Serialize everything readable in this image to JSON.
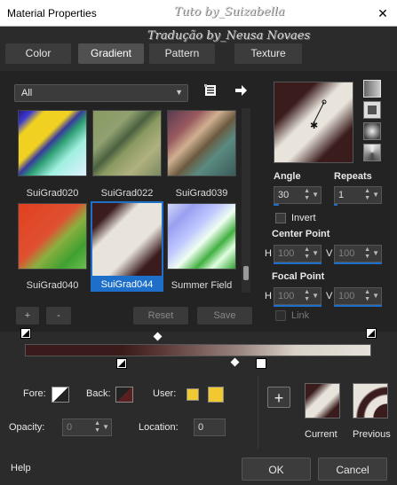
{
  "window": {
    "title": "Material Properties",
    "close_glyph": "✕"
  },
  "watermark": {
    "line1": "Tuto by_Suizabella",
    "line2": "Tradução by_Neusa Novaes"
  },
  "tabs": [
    {
      "label": "Color",
      "active": false
    },
    {
      "label": "Gradient",
      "active": true
    },
    {
      "label": "Pattern",
      "active": false
    },
    {
      "label": "Texture",
      "active": false
    }
  ],
  "library": {
    "category": "All",
    "gradients": [
      {
        "name": "SuiGrad020",
        "selected": false
      },
      {
        "name": "SuiGrad022",
        "selected": false
      },
      {
        "name": "SuiGrad039",
        "selected": false
      },
      {
        "name": "SuiGrad040",
        "selected": false
      },
      {
        "name": "SuiGrad044",
        "selected": true
      },
      {
        "name": "Summer Field",
        "selected": false
      }
    ],
    "add_label": "+",
    "remove_label": "-",
    "reset_label": "Reset",
    "save_label": "Save"
  },
  "settings": {
    "angle_label": "Angle",
    "angle_value": "30",
    "repeats_label": "Repeats",
    "repeats_value": "1",
    "invert_label": "Invert",
    "invert_checked": false,
    "center_point_label": "Center Point",
    "center_h_label": "H",
    "center_h": "100",
    "center_v_label": "V",
    "center_v": "100",
    "focal_point_label": "Focal Point",
    "focal_h_label": "H",
    "focal_h": "100",
    "focal_v_label": "V",
    "focal_v": "100",
    "link_label": "Link",
    "link_checked": false
  },
  "editor": {
    "fore_label": "Fore:",
    "back_label": "Back:",
    "user_label": "User:",
    "user_color": "#f0c830",
    "opacity_label": "Opacity:",
    "opacity_value": "0",
    "location_label": "Location:",
    "location_value": "0",
    "plus_glyph": "+"
  },
  "compare": {
    "current_label": "Current",
    "previous_label": "Previous"
  },
  "footer": {
    "help_label": "Help",
    "ok_label": "OK",
    "cancel_label": "Cancel"
  },
  "colors": {
    "accent": "#1e6fc9",
    "dark_stop": "#3a1c1c",
    "light_stop": "#e8e4dc",
    "background": "#2b2b2b"
  }
}
